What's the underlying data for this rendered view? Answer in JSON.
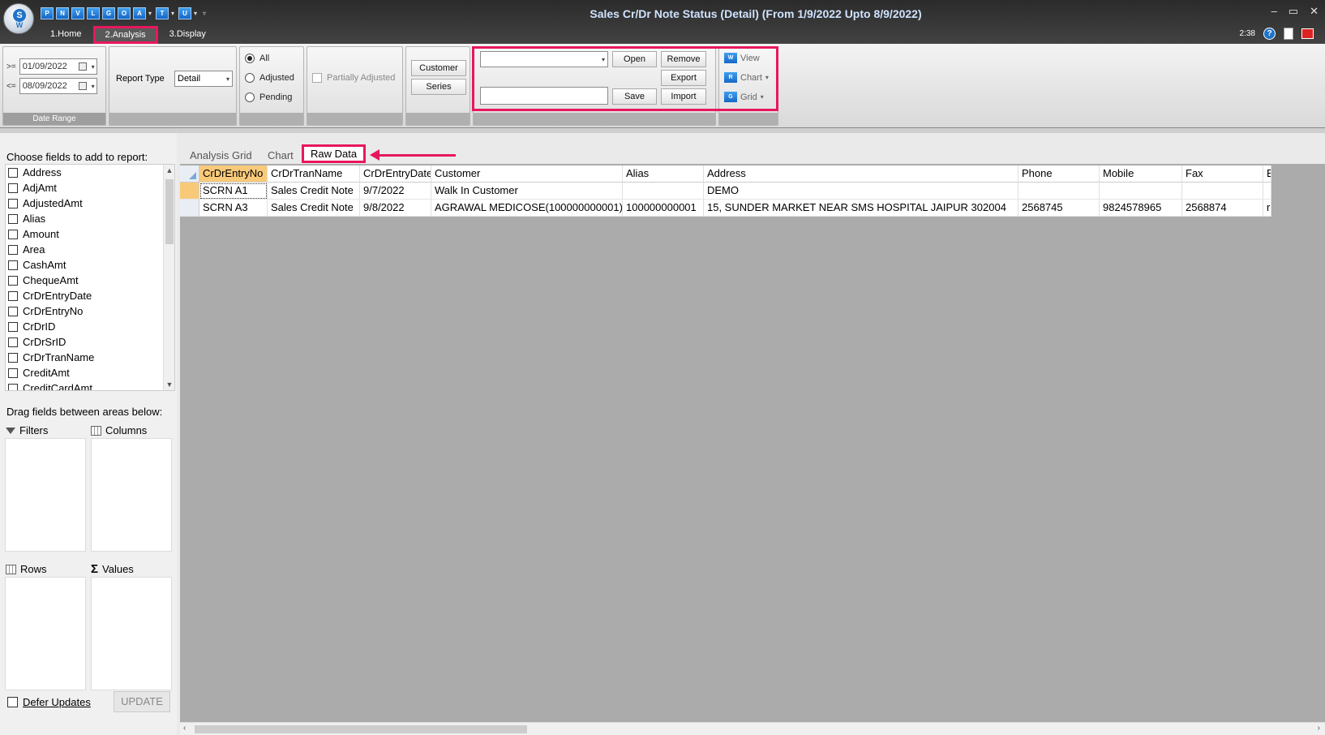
{
  "window": {
    "title": "Sales Cr/Dr Note Status (Detail)  (From 1/9/2022 Upto 8/9/2022)",
    "time": "2:38",
    "controls": {
      "minimize": "–",
      "maximize": "▭",
      "close": "✕"
    }
  },
  "quick_access": [
    "P",
    "N",
    "V",
    "L",
    "G",
    "O",
    "A",
    "T",
    "U"
  ],
  "ribbon_tabs": [
    {
      "label": "1.Home",
      "active": false
    },
    {
      "label": "2.Analysis",
      "active": true
    },
    {
      "label": "3.Display",
      "active": false
    }
  ],
  "date_range": {
    "from_op": ">=",
    "from": "01/09/2022",
    "to_op": "<=",
    "to": "08/09/2022",
    "label": "Date Range"
  },
  "report_type": {
    "label": "Report Type",
    "value": "Detail"
  },
  "status_filter": {
    "options": [
      "All",
      "Adjusted",
      "Pending"
    ],
    "selected": "All"
  },
  "partial": {
    "label": "Partially Adjusted"
  },
  "buttons": {
    "customer": "Customer",
    "series": "Series",
    "open": "Open",
    "remove": "Remove",
    "export": "Export",
    "save": "Save",
    "import": "Import"
  },
  "side_actions": [
    {
      "label": "View",
      "icon": "W"
    },
    {
      "label": "Chart",
      "icon": "R"
    },
    {
      "label": "Grid",
      "icon": "G"
    }
  ],
  "field_panel": {
    "header": "Choose fields to add to report:",
    "fields": [
      "Address",
      "AdjAmt",
      "AdjustedAmt",
      "Alias",
      "Amount",
      "Area",
      "CashAmt",
      "ChequeAmt",
      "CrDrEntryDate",
      "CrDrEntryNo",
      "CrDrID",
      "CrDrSrID",
      "CrDrTranName",
      "CreditAmt",
      "CreditCardAmt"
    ],
    "drag_label": "Drag fields between areas below:",
    "areas": {
      "filters": "Filters",
      "columns": "Columns",
      "rows": "Rows",
      "values": "Values"
    },
    "defer_label": "Defer Updates",
    "update_label": "UPDATE"
  },
  "view_tabs": [
    {
      "label": "Analysis Grid",
      "active": false
    },
    {
      "label": "Chart",
      "active": false
    },
    {
      "label": "Raw Data",
      "active": true
    }
  ],
  "grid": {
    "columns": [
      "CrDrEntryNo",
      "CrDrTranName",
      "CrDrEntryDate",
      "Customer",
      "Alias",
      "Address",
      "Phone",
      "Mobile",
      "Fax",
      "E"
    ],
    "rows": [
      [
        "SCRN A1",
        "Sales Credit Note",
        "9/7/2022",
        "Walk In Customer",
        "",
        " DEMO",
        "",
        "",
        "",
        ""
      ],
      [
        "SCRN A3",
        "Sales Credit Note",
        "9/8/2022",
        "AGRAWAL MEDICOSE(100000000001)",
        "100000000001",
        "15, SUNDER MARKET NEAR SMS HOSPITAL JAIPUR 302004",
        "2568745",
        "9824578965",
        "2568874",
        "r"
      ]
    ]
  },
  "colors": {
    "highlight": "#e8175d",
    "selected_header": "#f9c97a"
  }
}
